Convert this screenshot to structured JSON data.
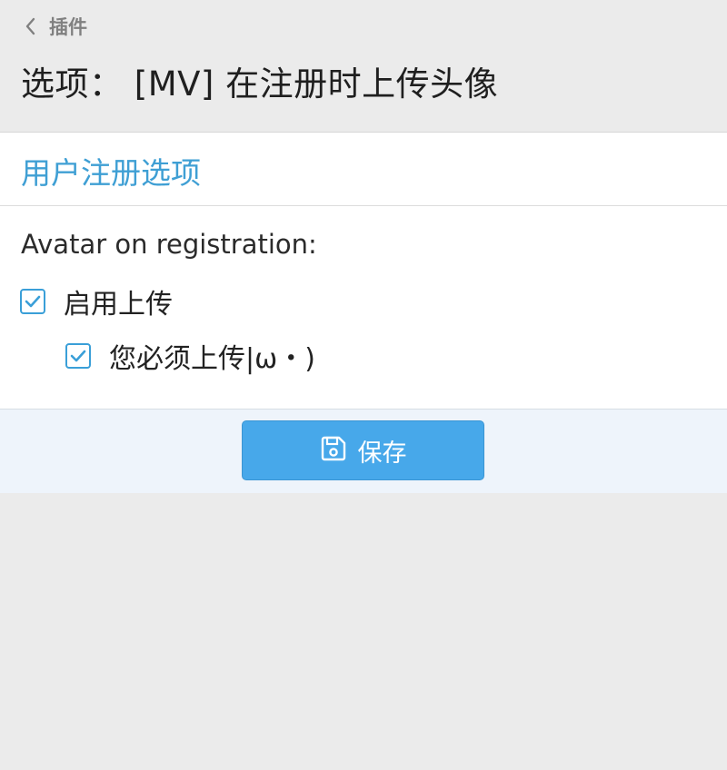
{
  "header": {
    "back_label": "插件",
    "title": "选项： [MV] 在注册时上传头像"
  },
  "section": {
    "title": "用户注册选项"
  },
  "form": {
    "field_label": "Avatar on registration:",
    "options": [
      {
        "label": "启用上传",
        "checked": true
      },
      {
        "label": "您必须上传|ω・)",
        "checked": true
      }
    ]
  },
  "actions": {
    "save_label": "保存"
  },
  "colors": {
    "accent": "#3f9fd4",
    "button": "#47a8ea",
    "background": "#ebebeb"
  }
}
